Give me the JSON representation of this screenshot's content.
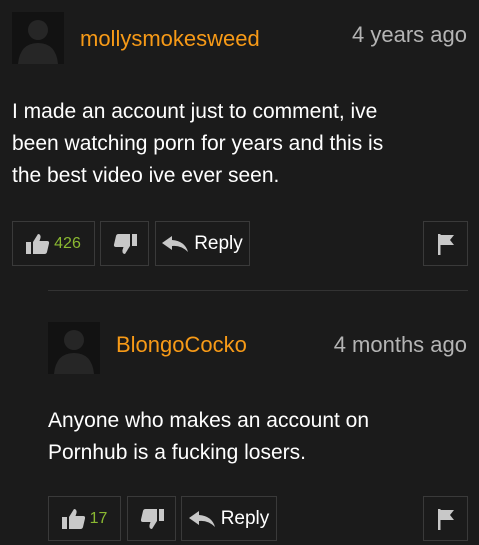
{
  "comments": [
    {
      "username": "mollysmokesweed",
      "timestamp": "4 years ago",
      "text_lines": [
        "I made an account just to comment, ive",
        "been watching porn for years and this is",
        "the best video ive ever seen."
      ],
      "likes": "426",
      "reply_label": "Reply"
    },
    {
      "username": "BlongoCocko",
      "timestamp": "4 months ago",
      "text_lines": [
        "Anyone who makes an account on",
        "Pornhub is a fucking losers."
      ],
      "likes": "17",
      "reply_label": "Reply"
    }
  ],
  "icons": {
    "avatar": "default-avatar-silhouette",
    "like": "thumbs-up-icon",
    "dislike": "thumbs-down-icon",
    "reply": "reply-arrow-icon",
    "flag": "flag-icon"
  },
  "colors": {
    "background": "#1b1b1b",
    "username": "#f79a17",
    "timestamp": "#b4b4b4",
    "like_count": "#8ab831",
    "text": "#ffffff",
    "button_border": "#3a3a3a"
  }
}
